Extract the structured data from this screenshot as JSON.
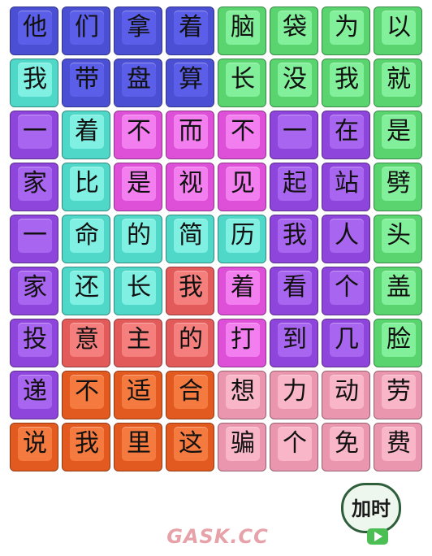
{
  "palette": {
    "blue": [
      "#4b4fd4",
      "#5b5ee8"
    ],
    "green": [
      "#59d46e",
      "#82f09a"
    ],
    "teal": [
      "#4fd8c7",
      "#80f0e2"
    ],
    "purple": [
      "#8d45dc",
      "#a865f0"
    ],
    "magenta": [
      "#df50d8",
      "#f37ef0"
    ],
    "red": [
      "#e25a59",
      "#f47f7d"
    ],
    "orange": [
      "#e25a20",
      "#f47a3f"
    ],
    "pink": [
      "#e996ae",
      "#f8b6c8"
    ]
  },
  "grid": [
    [
      [
        "他",
        "blue"
      ],
      [
        "们",
        "blue"
      ],
      [
        "拿",
        "blue"
      ],
      [
        "着",
        "blue"
      ],
      [
        "脑",
        "green"
      ],
      [
        "袋",
        "green"
      ],
      [
        "为",
        "green"
      ],
      [
        "以",
        "green"
      ]
    ],
    [
      [
        "我",
        "teal"
      ],
      [
        "带",
        "blue"
      ],
      [
        "盘",
        "blue"
      ],
      [
        "算",
        "blue"
      ],
      [
        "长",
        "green"
      ],
      [
        "没",
        "green"
      ],
      [
        "我",
        "green"
      ],
      [
        "就",
        "green"
      ]
    ],
    [
      [
        "一",
        "purple"
      ],
      [
        "着",
        "teal"
      ],
      [
        "不",
        "magenta"
      ],
      [
        "而",
        "magenta"
      ],
      [
        "不",
        "magenta"
      ],
      [
        "一",
        "purple"
      ],
      [
        "在",
        "purple"
      ],
      [
        "是",
        "green"
      ]
    ],
    [
      [
        "家",
        "purple"
      ],
      [
        "比",
        "teal"
      ],
      [
        "是",
        "magenta"
      ],
      [
        "视",
        "magenta"
      ],
      [
        "见",
        "magenta"
      ],
      [
        "起",
        "purple"
      ],
      [
        "站",
        "purple"
      ],
      [
        "劈",
        "green"
      ]
    ],
    [
      [
        "一",
        "purple"
      ],
      [
        "命",
        "teal"
      ],
      [
        "的",
        "teal"
      ],
      [
        "简",
        "teal"
      ],
      [
        "历",
        "teal"
      ],
      [
        "我",
        "purple"
      ],
      [
        "人",
        "purple"
      ],
      [
        "头",
        "green"
      ]
    ],
    [
      [
        "家",
        "purple"
      ],
      [
        "还",
        "teal"
      ],
      [
        "长",
        "teal"
      ],
      [
        "我",
        "red"
      ],
      [
        "着",
        "magenta"
      ],
      [
        "看",
        "purple"
      ],
      [
        "个",
        "purple"
      ],
      [
        "盖",
        "green"
      ]
    ],
    [
      [
        "投",
        "purple"
      ],
      [
        "意",
        "red"
      ],
      [
        "主",
        "red"
      ],
      [
        "的",
        "red"
      ],
      [
        "打",
        "magenta"
      ],
      [
        "到",
        "purple"
      ],
      [
        "几",
        "purple"
      ],
      [
        "脸",
        "green"
      ]
    ],
    [
      [
        "递",
        "purple"
      ],
      [
        "不",
        "orange"
      ],
      [
        "适",
        "orange"
      ],
      [
        "合",
        "orange"
      ],
      [
        "想",
        "pink"
      ],
      [
        "力",
        "pink"
      ],
      [
        "动",
        "pink"
      ],
      [
        "劳",
        "pink"
      ]
    ],
    [
      [
        "说",
        "orange"
      ],
      [
        "我",
        "orange"
      ],
      [
        "里",
        "orange"
      ],
      [
        "这",
        "orange"
      ],
      [
        "骗",
        "pink"
      ],
      [
        "个",
        "pink"
      ],
      [
        "免",
        "pink"
      ],
      [
        "费",
        "pink"
      ]
    ]
  ],
  "bonus_button": {
    "label": "加时",
    "icon": "video-icon"
  },
  "watermark": "GASK.CC"
}
